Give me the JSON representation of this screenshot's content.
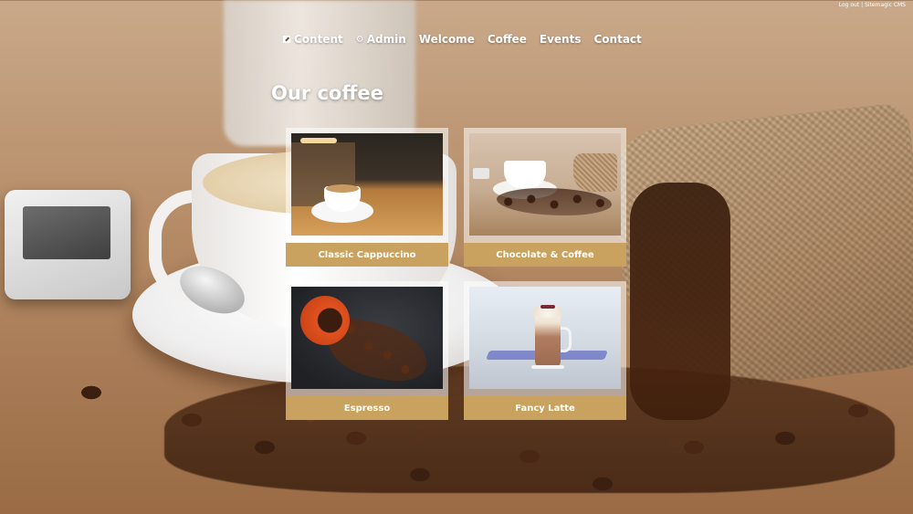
{
  "topbar": {
    "logout_label": "Log out",
    "separator": "|",
    "cms_label": "Sitemagic CMS"
  },
  "nav": {
    "items": [
      {
        "label": "Content",
        "icon": "edit-icon"
      },
      {
        "label": "Admin",
        "icon": "gear-icon"
      },
      {
        "label": "Welcome"
      },
      {
        "label": "Coffee"
      },
      {
        "label": "Events"
      },
      {
        "label": "Contact"
      }
    ]
  },
  "page": {
    "title": "Our coffee"
  },
  "products": [
    {
      "name": "Classic Cappuccino",
      "image": "cappuccino-photo"
    },
    {
      "name": "Chocolate & Coffee",
      "image": "chocolate-coffee-photo"
    },
    {
      "name": "Espresso",
      "image": "espresso-photo"
    },
    {
      "name": "Fancy Latte",
      "image": "fancy-latte-photo"
    }
  ],
  "colors": {
    "caption_bar": "#c9a25f",
    "nav_text": "#ffffff",
    "tile_frame": "rgba(255,255,255,0.55)"
  }
}
